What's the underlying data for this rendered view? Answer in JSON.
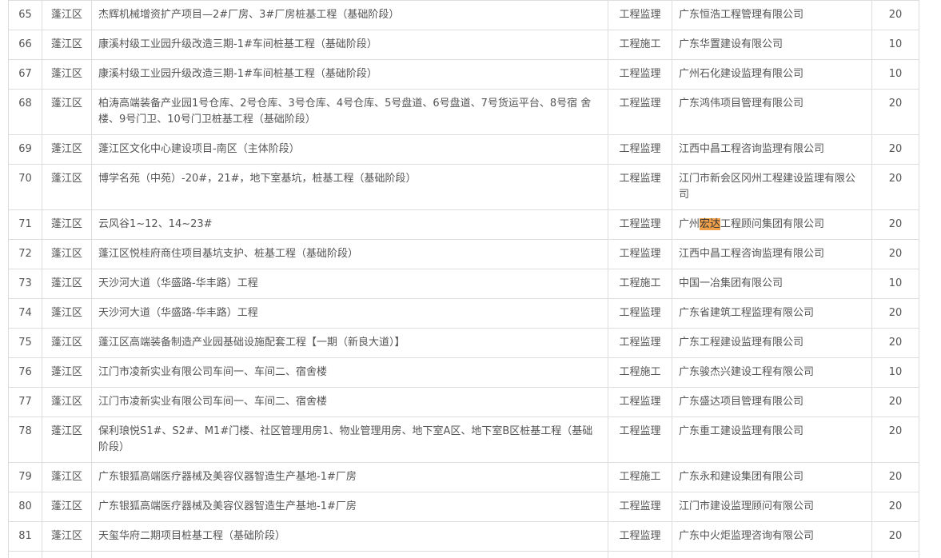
{
  "rows": [
    {
      "no": "65",
      "district": "蓬江区",
      "project": "杰辉机械增资扩产项目—2#厂房、3#厂房桩基工程（基础阶段）",
      "type": "工程监理",
      "company": "广东恒浩工程管理有限公司",
      "score": "20"
    },
    {
      "no": "66",
      "district": "蓬江区",
      "project": "康溪村级工业园升级改造三期-1#车间桩基工程（基础阶段）",
      "type": "工程施工",
      "company": "广东华置建设有限公司",
      "score": "10"
    },
    {
      "no": "67",
      "district": "蓬江区",
      "project": "康溪村级工业园升级改造三期-1#车间桩基工程（基础阶段）",
      "type": "工程监理",
      "company": "广州石化建设监理有限公司",
      "score": "10"
    },
    {
      "no": "68",
      "district": "蓬江区",
      "project": "柏涛高端装备产业园1号仓库、2号仓库、3号仓库、4号仓库、5号盘道、6号盘道、7号货运平台、8号宿 舍楼、9号门卫、10号门卫桩基工程（基础阶段）",
      "type": "工程监理",
      "company": "广东鸿伟项目管理有限公司",
      "score": "20"
    },
    {
      "no": "69",
      "district": "蓬江区",
      "project": "蓬江区文化中心建设项目-南区（主体阶段）",
      "type": "工程监理",
      "company": "江西中昌工程咨询监理有限公司",
      "score": "20"
    },
    {
      "no": "70",
      "district": "蓬江区",
      "project": "博学名苑（中苑）-20#，21#，地下室基坑，桩基工程（基础阶段）",
      "type": "工程监理",
      "company": "江门市新会区冈州工程建设监理有限公司",
      "score": "20"
    },
    {
      "no": "71",
      "district": "蓬江区",
      "project": "云风谷1~12、14~23#",
      "type": "工程监理",
      "company_pre": "广州",
      "company_hl": "宏达",
      "company_post": "工程顾问集团有限公司",
      "score": "20"
    },
    {
      "no": "72",
      "district": "蓬江区",
      "project": "蓬江区悦桂府商住项目基坑支护、桩基工程（基础阶段）",
      "type": "工程监理",
      "company": "江西中昌工程咨询监理有限公司",
      "score": "20"
    },
    {
      "no": "73",
      "district": "蓬江区",
      "project": "天沙河大道（华盛路-华丰路）工程",
      "type": "工程施工",
      "company": "中国一冶集团有限公司",
      "score": "10"
    },
    {
      "no": "74",
      "district": "蓬江区",
      "project": "天沙河大道（华盛路-华丰路）工程",
      "type": "工程监理",
      "company": "广东省建筑工程监理有限公司",
      "score": "20"
    },
    {
      "no": "75",
      "district": "蓬江区",
      "project": "蓬江区高端装备制造产业园基础设施配套工程【一期（新良大道）】",
      "type": "工程监理",
      "company": "广东工程建设监理有限公司",
      "score": "20"
    },
    {
      "no": "76",
      "district": "蓬江区",
      "project": "江门市凌新实业有限公司车间一、车间二、宿舍楼",
      "type": "工程施工",
      "company": "广东骏杰兴建设工程有限公司",
      "score": "10"
    },
    {
      "no": "77",
      "district": "蓬江区",
      "project": "江门市凌新实业有限公司车间一、车间二、宿舍楼",
      "type": "工程监理",
      "company": "广东盛达项目管理有限公司",
      "score": "20"
    },
    {
      "no": "78",
      "district": "蓬江区",
      "project": "保利琅悦S1#、S2#、M1#门楼、社区管理用房1、物业管理用房、地下室A区、地下室B区桩基工程（基础阶段）",
      "type": "工程监理",
      "company": "广东重工建设监理有限公司",
      "score": "20"
    },
    {
      "no": "79",
      "district": "蓬江区",
      "project": "广东银狐高端医疗器械及美容仪器智造生产基地-1#厂房",
      "type": "工程施工",
      "company": "广东永和建设集团有限公司",
      "score": "20"
    },
    {
      "no": "80",
      "district": "蓬江区",
      "project": "广东银狐高端医疗器械及美容仪器智造生产基地-1#厂房",
      "type": "工程监理",
      "company": "江门市建设监理顾问有限公司",
      "score": "20"
    },
    {
      "no": "81",
      "district": "蓬江区",
      "project": "天玺华府二期项目桩基工程（基础阶段）",
      "type": "工程监理",
      "company": "广东中火炬监理咨询有限公司",
      "score": "20"
    }
  ],
  "colors": {
    "border": "#dddddd",
    "text": "#555555",
    "highlight": "#f0a04b"
  }
}
